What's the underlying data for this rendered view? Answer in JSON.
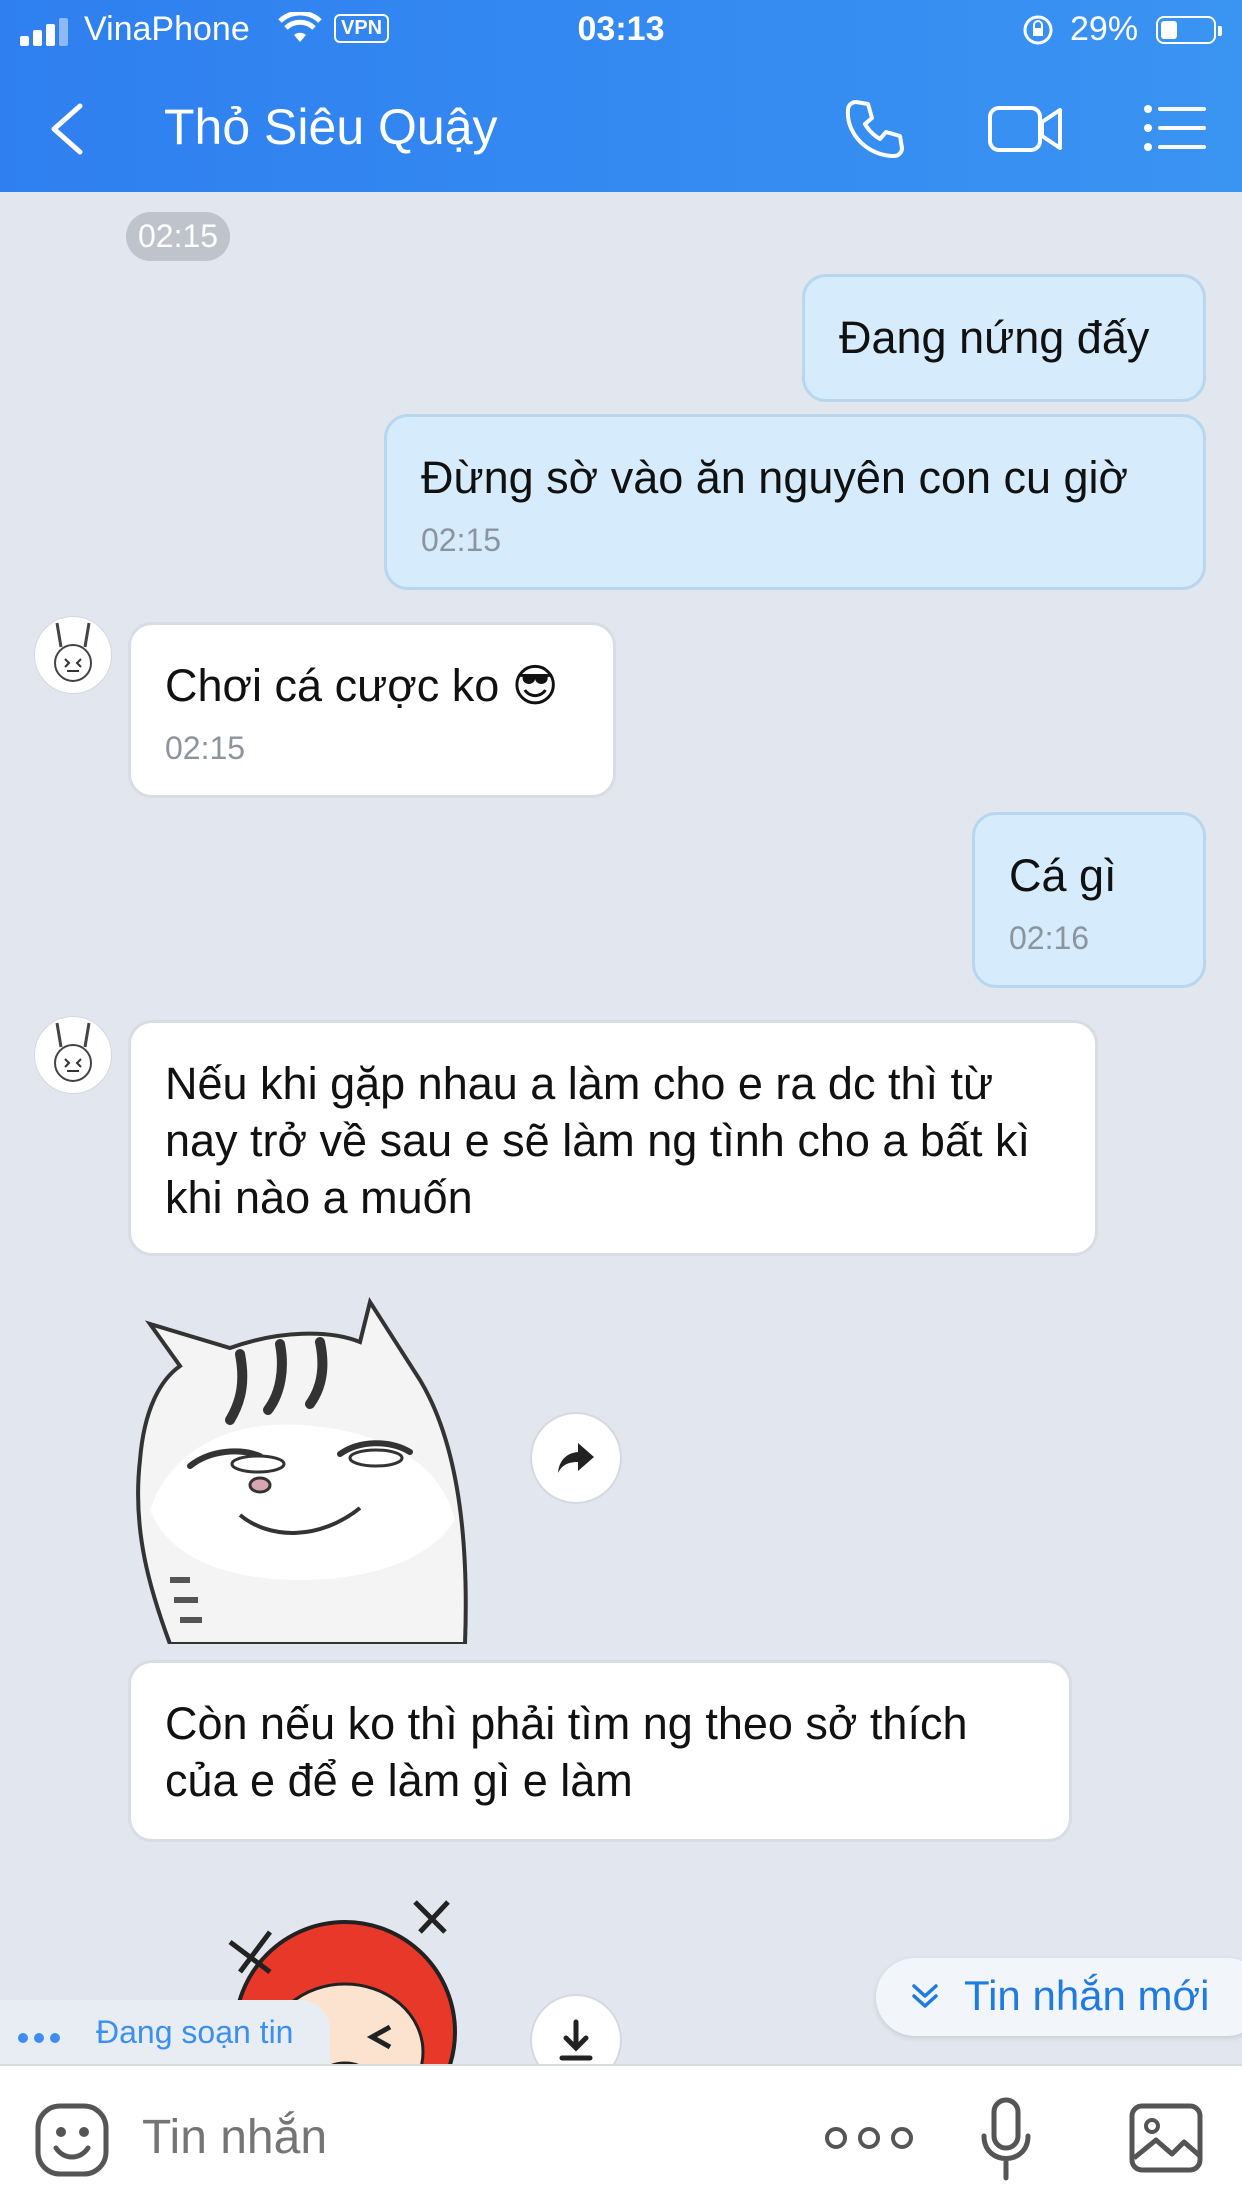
{
  "status_bar": {
    "carrier": "VinaPhone",
    "vpn": "VPN",
    "time": "03:13",
    "battery": "29%",
    "icons": [
      "signal-icon",
      "wifi-icon",
      "lock-rotation-icon",
      "battery-icon"
    ]
  },
  "header": {
    "title": "Thỏ Siêu Quậy",
    "icons": [
      "back-icon",
      "phone-icon",
      "video-icon",
      "menu-icon"
    ]
  },
  "chat": {
    "time_pill": "02:15",
    "messages": [
      {
        "dir": "out",
        "text": "Đang nứng đấy"
      },
      {
        "dir": "out",
        "text": "Đừng sờ vào ăn nguyên con cu giờ",
        "time": "02:15"
      },
      {
        "dir": "in",
        "text": "Chơi cá cược ko",
        "emoji": "😎",
        "time": "02:15"
      },
      {
        "dir": "out",
        "text": "Cá gì",
        "time": "02:16"
      },
      {
        "dir": "in",
        "text": "Nếu khi gặp nhau a làm cho e ra dc thì từ nay trở về sau e sẽ làm ng tình cho a bất kì khi nào a muốn"
      },
      {
        "dir": "in",
        "text": "Còn nếu ko thì phải tìm ng theo sở thích của e để e làm gì e làm"
      }
    ],
    "stickers": [
      "cat-sticker",
      "monkey-sticker"
    ]
  },
  "typing_indicator": "Đang soạn tin",
  "new_message_button": "Tin nhắn mới",
  "input": {
    "placeholder": "Tin nhắn",
    "icons": [
      "sticker-icon",
      "more-icon",
      "mic-icon",
      "image-icon"
    ]
  },
  "colors": {
    "header": "#2f7ff0",
    "bubble_out": "#d6ebfb",
    "bubble_in": "#ffffff",
    "background": "#e2e6ee",
    "accent": "#1f7be4"
  }
}
